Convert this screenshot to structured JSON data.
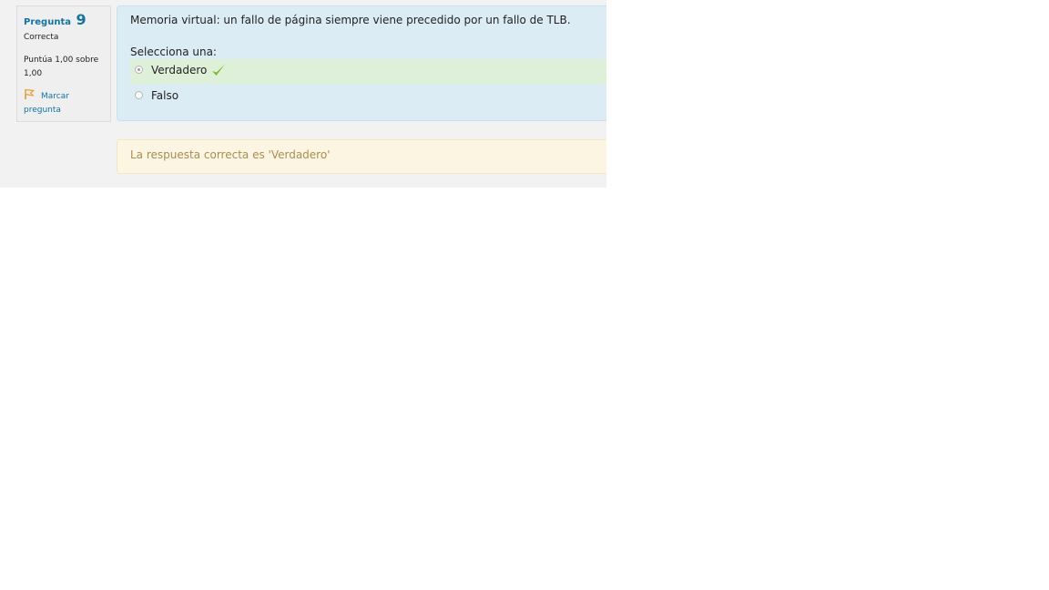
{
  "info": {
    "question_label": "Pregunta",
    "question_number": "9",
    "state": "Correcta",
    "grade": "Puntúa 1,00 sobre 1,00",
    "flag_label": "Marcar pregunta"
  },
  "formulation": {
    "question_text": "Memoria virtual: un fallo de página siempre viene precedido por un fallo de TLB.",
    "prompt": "Selecciona una:",
    "answers": [
      {
        "label": "Verdadero",
        "selected": true,
        "correct": true
      },
      {
        "label": "Falso",
        "selected": false,
        "correct": false
      }
    ]
  },
  "feedback": {
    "right_answer": "La respuesta correcta es 'Verdadero'"
  },
  "colors": {
    "accent": "#0f74a8",
    "formulation_bg": "#dbecf5",
    "correct_bg": "#dff0d8",
    "check_green": "#7cb92c",
    "flag_orange": "#f0a22a",
    "feedback_text": "#ac8d4f",
    "feedback_bg": "#fcf5e2"
  },
  "icons": {
    "flag": "flag-icon",
    "check": "check-icon"
  }
}
